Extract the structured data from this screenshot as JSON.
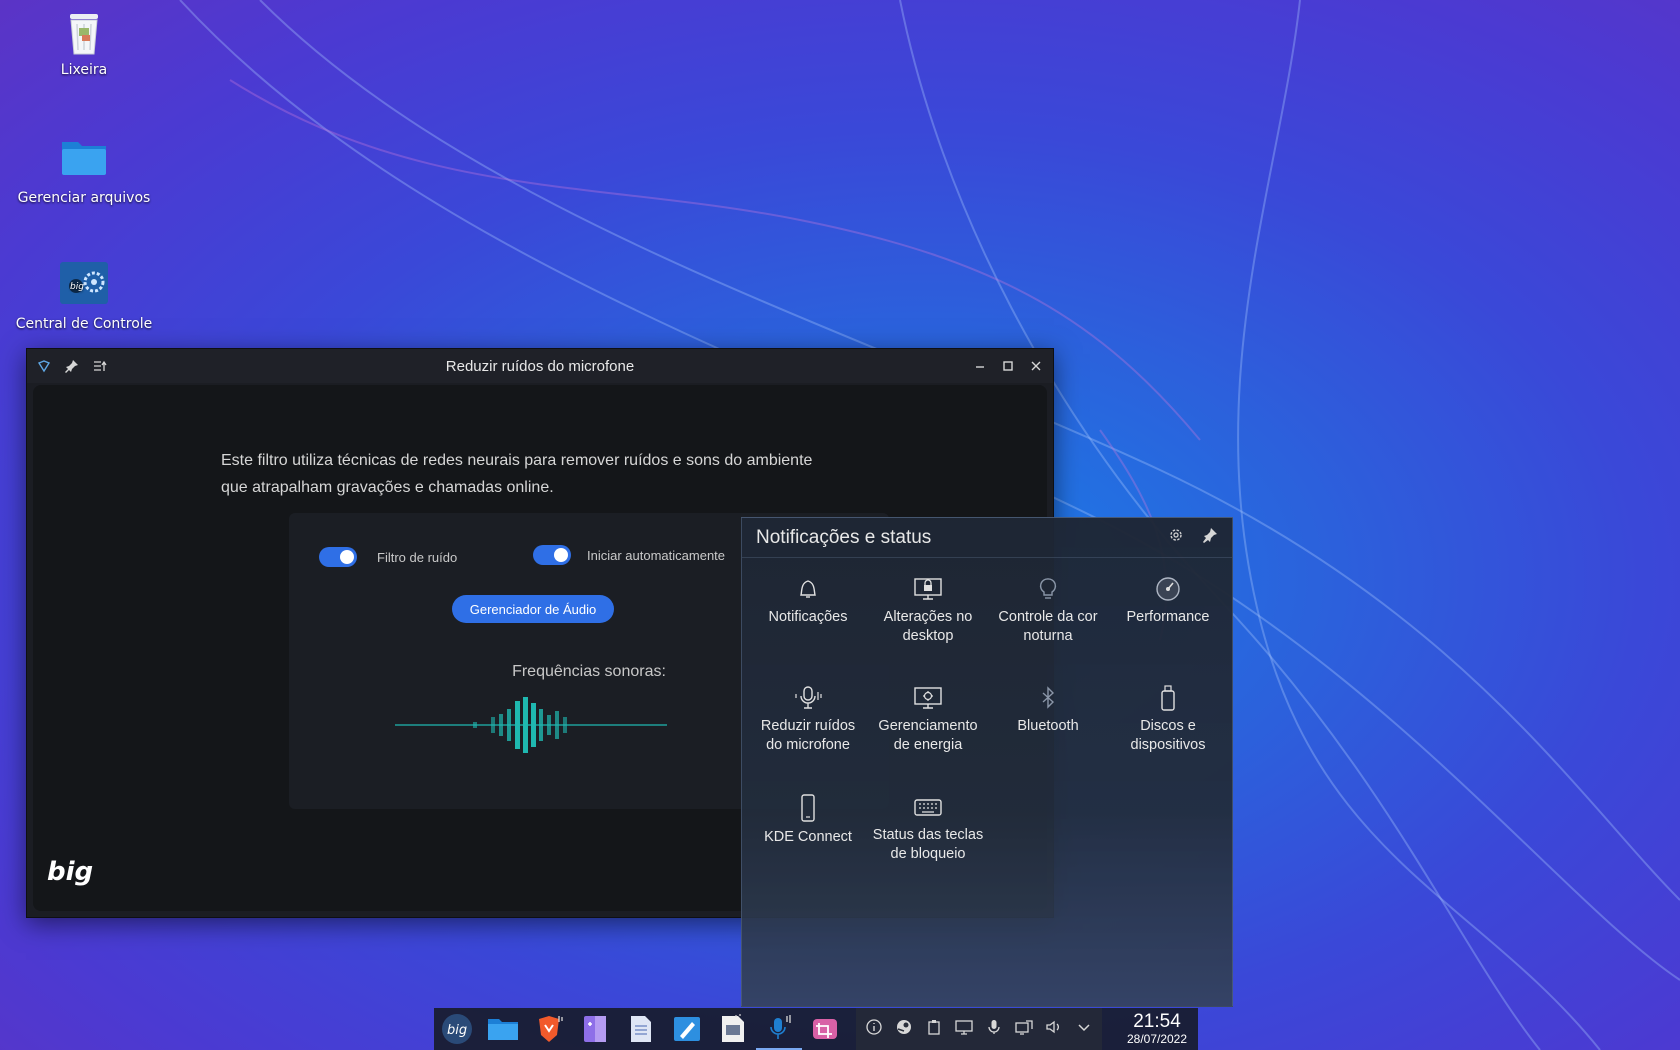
{
  "desktop": {
    "icons": [
      {
        "label": "Lixeira",
        "icon": "trash-icon"
      },
      {
        "label": "Gerenciar arquivos",
        "icon": "folder-icon"
      },
      {
        "label": "Central de Controle",
        "icon": "control-center-icon"
      }
    ]
  },
  "window": {
    "title": "Reduzir ruídos do microfone",
    "description_line1": "Este filtro utiliza técnicas de redes neurais para remover ruídos e sons do ambiente",
    "description_line2": "que atrapalham gravações e chamadas online.",
    "toggle_noise_label": "Filtro de ruído",
    "toggle_noise_on": true,
    "toggle_autostart_label": "Iniciar automaticamente",
    "toggle_autostart_on": true,
    "audio_manager_button": "Gerenciador de Áudio",
    "frequencies_label": "Frequências sonoras:",
    "logo_text": "big"
  },
  "panel": {
    "title": "Notificações e status",
    "items": [
      {
        "label1": "Notificações",
        "label2": "",
        "icon": "bell-icon"
      },
      {
        "label1": "Alterações no",
        "label2": "desktop",
        "icon": "desktop-lock-icon"
      },
      {
        "label1": "Controle da cor",
        "label2": "noturna",
        "icon": "bulb-icon"
      },
      {
        "label1": "Performance",
        "label2": "",
        "icon": "gauge-icon"
      },
      {
        "label1": "Reduzir ruídos",
        "label2": "do microfone",
        "icon": "microphone-icon"
      },
      {
        "label1": "Gerenciamento",
        "label2": "de energia",
        "icon": "power-management-icon"
      },
      {
        "label1": "Bluetooth",
        "label2": "",
        "icon": "bluetooth-icon"
      },
      {
        "label1": "Discos e",
        "label2": "dispositivos",
        "icon": "usb-drive-icon"
      },
      {
        "label1": "KDE Connect",
        "label2": "",
        "icon": "phone-icon"
      },
      {
        "label1": "Status das teclas",
        "label2": "de bloqueio",
        "icon": "keyboard-icon"
      }
    ]
  },
  "taskbar": {
    "clock_time": "21:54",
    "clock_date": "28/07/2022"
  },
  "colors": {
    "accent": "#2f6fe6",
    "wave": "#1fb8b0"
  }
}
